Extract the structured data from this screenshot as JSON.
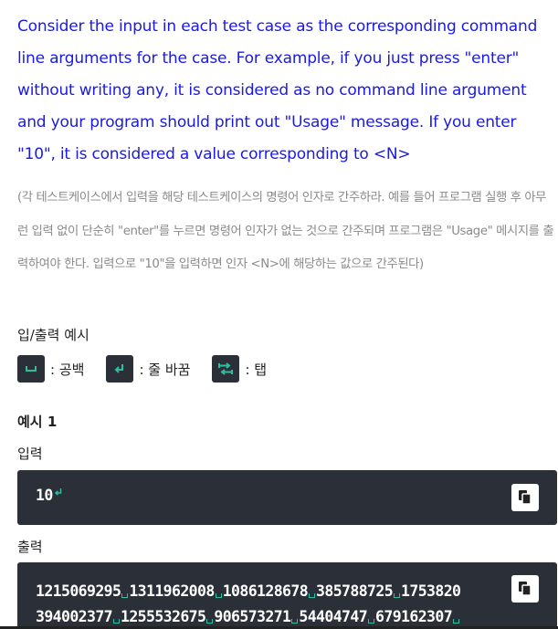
{
  "intro": {
    "english": "Consider the input in each test case as the corresponding command line arguments for the case. For example, if you just press \"enter\" without writing any, it is considered as no command line argument and your program should print out \"Usage\" message. If you enter \"10\", it is considered a value corresponding to <N>",
    "korean": "(각 테스트케이스에서 입력을 해당 테스트케이스의 명령어 인자로 간주하라. 예를 들어 프로그램 실행 후 아무런 입력 없이 단순히 \"enter\"를 누르면 명령어 인자가 없는 것으로 간주되며 프로그램은 \"Usage\" 메시지를 출력하여야 한다. 입력으로 \"10\"을 입력하면 인자 <N>에 해당하는 값으로 간주된다)"
  },
  "io_section": {
    "title": "입/출력 예시",
    "legend": [
      {
        "icon": "space-icon",
        "label": ": 공백"
      },
      {
        "icon": "newline-icon",
        "label": ": 줄 바꿈"
      },
      {
        "icon": "tab-icon",
        "label": ": 탭"
      }
    ]
  },
  "example": {
    "title": "예시 1",
    "input_label": "입력",
    "input_value": "10",
    "output_label": "출력",
    "output_lines": [
      [
        "1215069295",
        "1311962008",
        "1086128678",
        "385788725",
        "1753820"
      ],
      [
        "394002377",
        "1255532675",
        "906573271",
        "54404747",
        "679162307"
      ]
    ]
  },
  "colors": {
    "link_text": "#1a1ae6",
    "muted_text": "#8a8a8a",
    "code_bg": "#2b3038",
    "whitespace_marker": "#2bbf9f"
  }
}
